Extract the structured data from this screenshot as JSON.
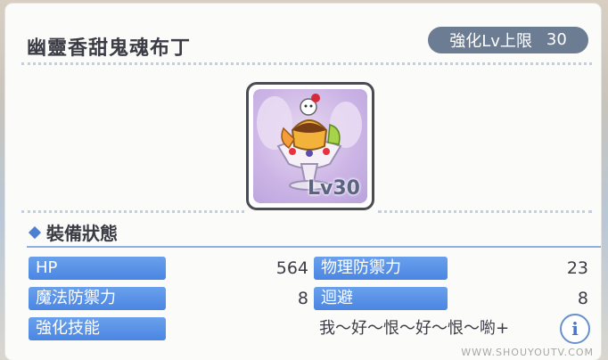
{
  "item": {
    "name": "幽靈香甜鬼魂布丁",
    "limit_label": "強化Lv上限",
    "limit_value": "30",
    "level_label": "Lv30"
  },
  "status": {
    "section_title": "裝備狀態",
    "rows": [
      {
        "label": "HP",
        "value": "564"
      },
      {
        "label": "物理防禦力",
        "value": "23"
      },
      {
        "label": "魔法防禦力",
        "value": "8"
      },
      {
        "label": "迴避",
        "value": "8"
      }
    ],
    "skill_label": "強化技能",
    "skill_value": "我～好～恨～好～恨～喲+"
  },
  "info_button": "i",
  "watermark": "WWW.SHOUYOUTV.COM",
  "colors": {
    "label_bg": "#4a85e2",
    "badge_bg": "#6c7c93",
    "text": "#3c3c46"
  }
}
